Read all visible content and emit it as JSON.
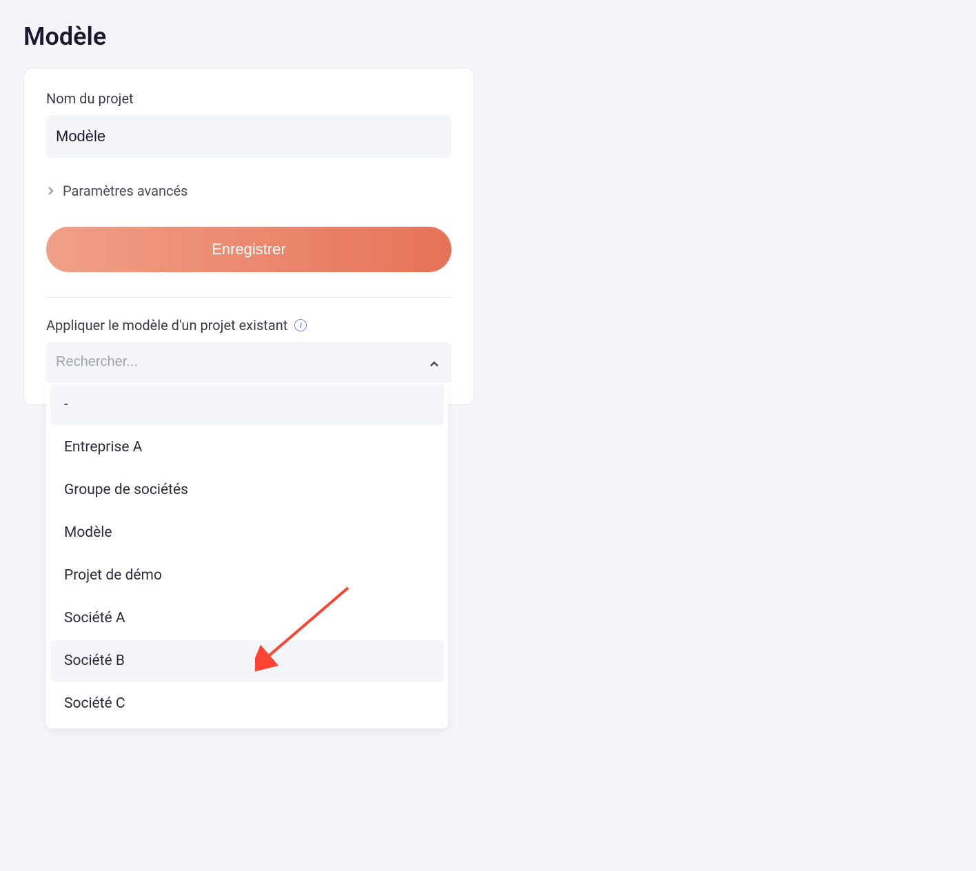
{
  "page": {
    "title": "Modèle"
  },
  "form": {
    "project_name_label": "Nom du projet",
    "project_name_value": "Modèle",
    "advanced_params_label": "Paramètres avancés",
    "save_button_label": "Enregistrer"
  },
  "template_section": {
    "label": "Appliquer le modèle d'un projet existant",
    "search_placeholder": "Rechercher...",
    "options": [
      {
        "label": "-",
        "selected": true,
        "highlighted": false
      },
      {
        "label": "Entreprise A",
        "selected": false,
        "highlighted": false
      },
      {
        "label": "Groupe de sociétés",
        "selected": false,
        "highlighted": false
      },
      {
        "label": "Modèle",
        "selected": false,
        "highlighted": false
      },
      {
        "label": "Projet de démo",
        "selected": false,
        "highlighted": false
      },
      {
        "label": "Société A",
        "selected": false,
        "highlighted": false
      },
      {
        "label": "Société B",
        "selected": false,
        "highlighted": true
      },
      {
        "label": "Société C",
        "selected": false,
        "highlighted": false
      }
    ]
  },
  "colors": {
    "accent_gradient_start": "#f0a088",
    "accent_gradient_end": "#e67358",
    "info_icon": "#6b8cff",
    "arrow": "#ff4433"
  }
}
